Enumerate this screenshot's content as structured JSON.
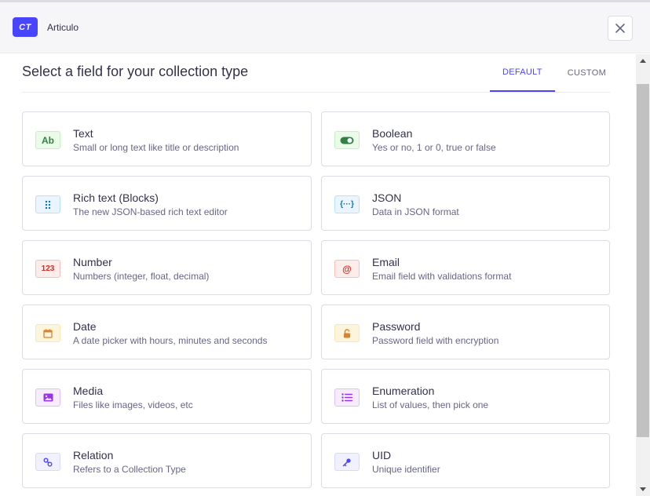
{
  "header": {
    "badge": "CT",
    "collection_name": "Articulo"
  },
  "main": {
    "title": "Select a field for your collection type",
    "tabs": [
      {
        "label": "DEFAULT",
        "active": true
      },
      {
        "label": "CUSTOM",
        "active": false
      }
    ]
  },
  "fields": [
    {
      "name": "Text",
      "description": "Small or long text like title or description",
      "icon": "text-icon",
      "glyph": "Ab",
      "color": "#328048",
      "bg": "#eafbe7",
      "border": "#c6f0c2"
    },
    {
      "name": "Boolean",
      "description": "Yes or no, 1 or 0, true or false",
      "icon": "toggle-icon",
      "color": "#328048",
      "bg": "#eafbe7",
      "border": "#c6f0c2"
    },
    {
      "name": "Rich text (Blocks)",
      "description": "The new JSON-based rich text editor",
      "icon": "drag-dots-icon",
      "color": "#0c75af",
      "bg": "#eaf5ff",
      "border": "#b8e1ff"
    },
    {
      "name": "JSON",
      "description": "Data in JSON format",
      "icon": "braces-icon",
      "glyph": "{···}",
      "color": "#0c75af",
      "bg": "#eaf5ff",
      "border": "#b8e1ff"
    },
    {
      "name": "Number",
      "description": "Numbers (integer, float, decimal)",
      "icon": "number-icon",
      "glyph": "123",
      "color": "#d02b20",
      "bg": "#fcecea",
      "border": "#f5c0b8"
    },
    {
      "name": "Email",
      "description": "Email field with validations format",
      "icon": "at-sign-icon",
      "glyph": "@",
      "color": "#d02b20",
      "bg": "#fcecea",
      "border": "#f5c0b8"
    },
    {
      "name": "Date",
      "description": "A date picker with hours, minutes and seconds",
      "icon": "calendar-icon",
      "color": "#d9822f",
      "bg": "#fdf4dc",
      "border": "#fae7b9"
    },
    {
      "name": "Password",
      "description": "Password field with encryption",
      "icon": "lock-icon",
      "color": "#d9822f",
      "bg": "#fdf4dc",
      "border": "#fae7b9"
    },
    {
      "name": "Media",
      "description": "Files like images, videos, etc",
      "icon": "image-icon",
      "color": "#9736e8",
      "bg": "#f6ecfc",
      "border": "#e0c1f4"
    },
    {
      "name": "Enumeration",
      "description": "List of values, then pick one",
      "icon": "list-icon",
      "color": "#9736e8",
      "bg": "#f6ecfc",
      "border": "#e0c1f4"
    },
    {
      "name": "Relation",
      "description": "Refers to a Collection Type",
      "icon": "link-icon",
      "color": "#4945ff",
      "bg": "#f0f0ff",
      "border": "#d9d8ff"
    },
    {
      "name": "UID",
      "description": "Unique identifier",
      "icon": "key-icon",
      "color": "#4945ff",
      "bg": "#f0f0ff",
      "border": "#d9d8ff"
    }
  ]
}
